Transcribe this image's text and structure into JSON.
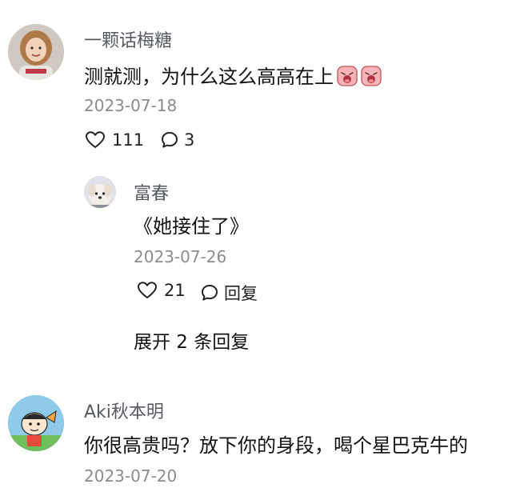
{
  "comments": [
    {
      "username": "一颗话梅糖",
      "text": "测就测，为什么这么高高在上",
      "emoji_icon": "crying-face-icon",
      "date": "2023-07-18",
      "likes": "111",
      "replies": "3"
    },
    {
      "username": "富春",
      "text": "《她接住了》",
      "date": "2023-07-26",
      "likes": "21",
      "reply_label": "回复",
      "expand_label": "展开 2 条回复"
    },
    {
      "username": "Aki秋本明",
      "text": "你很高贵吗？放下你的身段，喝个星巴克牛的",
      "date": "2023-07-20"
    }
  ],
  "colors": {
    "username": "#555a61",
    "text": "#111111",
    "date": "#8c8c8c",
    "icon": "#222222"
  },
  "icons": {
    "like": "heart-outline-icon",
    "comment": "speech-bubble-icon"
  }
}
